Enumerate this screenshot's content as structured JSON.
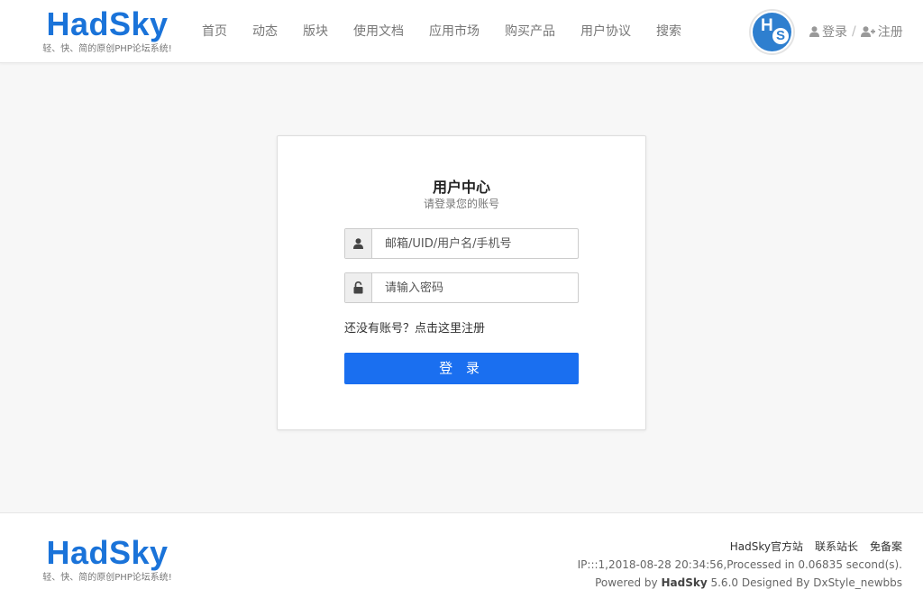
{
  "header": {
    "logo": "HadSky",
    "slogan": "轻、快、简的原创PHP论坛系统!",
    "nav": [
      "首页",
      "动态",
      "版块",
      "使用文档",
      "应用市场",
      "购买产品",
      "用户协议",
      "搜索"
    ],
    "avatar": {
      "letter1": "H",
      "letter2": "S"
    },
    "login": "登录",
    "separator": "/",
    "register": "注册"
  },
  "login_card": {
    "title": "用户中心",
    "subtitle": "请登录您的账号",
    "username_placeholder": "邮箱/UID/用户名/手机号",
    "username_value": "",
    "password_placeholder": "请输入密码",
    "password_value": "",
    "no_account_text": "还没有账号？",
    "register_link": "点击这里注册",
    "login_button": "登 录"
  },
  "footer": {
    "logo": "HadSky",
    "slogan": "轻、快、简的原创PHP论坛系统!",
    "links": [
      "HadSky官方站",
      "联系站长",
      "免备案"
    ],
    "stats": "IP:::1,2018-08-28 20:34:56,Processed in 0.06835 second(s).",
    "powered_prefix": "Powered by",
    "powered_brand": "HadSky",
    "powered_suffix": "5.6.0 Designed By DxStyle_newbbs"
  },
  "colors": {
    "brand": "#1a73d9",
    "button": "#1a6ff0",
    "background": "#f7f7f7"
  }
}
